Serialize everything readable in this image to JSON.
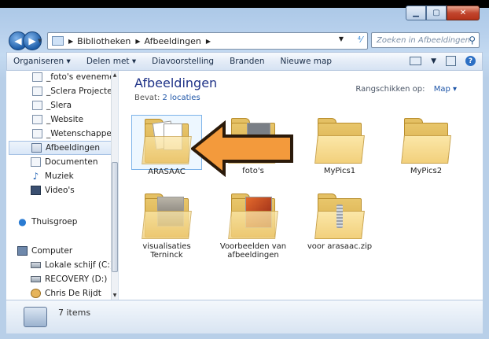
{
  "addressbar": {
    "crumbs": [
      "Bibliotheken",
      "Afbeeldingen"
    ],
    "search_placeholder": "Zoeken in Afbeeldingen"
  },
  "toolbar": {
    "organise": "Organiseren ▾",
    "share": "Delen met ▾",
    "slideshow": "Diavoorstelling",
    "burn": "Branden",
    "newfolder": "Nieuwe map"
  },
  "nav": {
    "items": [
      {
        "label": "_foto's evenemen",
        "icon": "document-icon"
      },
      {
        "label": "_Sclera Projecten",
        "icon": "document-icon"
      },
      {
        "label": "_Slera",
        "icon": "document-icon"
      },
      {
        "label": "_Website",
        "icon": "document-icon"
      },
      {
        "label": "_Wetenschappeli",
        "icon": "document-icon"
      },
      {
        "label": "Afbeeldingen",
        "icon": "library-icon",
        "selected": true
      },
      {
        "label": "Documenten",
        "icon": "library-icon"
      },
      {
        "label": "Muziek",
        "icon": "music-icon"
      },
      {
        "label": "Video's",
        "icon": "video-icon"
      }
    ],
    "homegroup": "Thuisgroep",
    "computer": "Computer",
    "drives": [
      {
        "label": "Lokale schijf (C:)"
      },
      {
        "label": "RECOVERY (D:)"
      },
      {
        "label": "Chris De Rijdt"
      }
    ]
  },
  "content": {
    "title": "Afbeeldingen",
    "includes_label": "Bevat:",
    "includes_link": "2 locaties",
    "arrange_label": "Rangschikken op:",
    "arrange_value": "Map ▾",
    "items": [
      {
        "name": "ARASAAC",
        "type": "folder"
      },
      {
        "name": "foto's",
        "type": "folder"
      },
      {
        "name": "MyPics1",
        "type": "folder"
      },
      {
        "name": "MyPics2",
        "type": "folder"
      },
      {
        "name": "visualisaties Terninck",
        "type": "folder"
      },
      {
        "name": "Voorbeelden van afbeeldingen",
        "type": "folder"
      },
      {
        "name": "voor arasaac.zip",
        "type": "zip"
      }
    ]
  },
  "status": {
    "count": "7 items"
  },
  "colors": {
    "titlebar": "#b7d0ec",
    "heading": "#1e3287",
    "arrow": "#f39a3c"
  }
}
